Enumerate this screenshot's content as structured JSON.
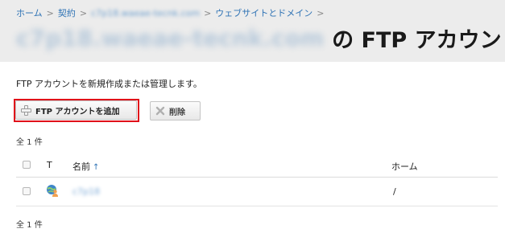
{
  "breadcrumb": {
    "items": [
      "ホーム",
      "契約",
      "c7p18.waeae-tecnk.com",
      "ウェブサイトとドメイン"
    ],
    "separator": ">"
  },
  "title": {
    "domain": "c7p18.waeae-tecnk.com",
    "suffix": "の FTP アカウント"
  },
  "description": "FTP アカウントを新規作成または管理します。",
  "toolbar": {
    "add_label": "FTP アカウントを追加",
    "delete_label": "削除"
  },
  "count_label": "全 1 件",
  "table": {
    "columns": [
      "T",
      "名前",
      "ホーム"
    ],
    "sort_indicator": "↑",
    "rows": [
      {
        "name": "c7p18",
        "home": "/"
      }
    ]
  },
  "colors": {
    "link": "#2f73b5",
    "highlight": "#e0101a",
    "header_bg": "#ececec"
  },
  "icons": {
    "add": "plus-icon",
    "delete": "delete-x-icon",
    "row_type": "ftp-user-icon"
  }
}
